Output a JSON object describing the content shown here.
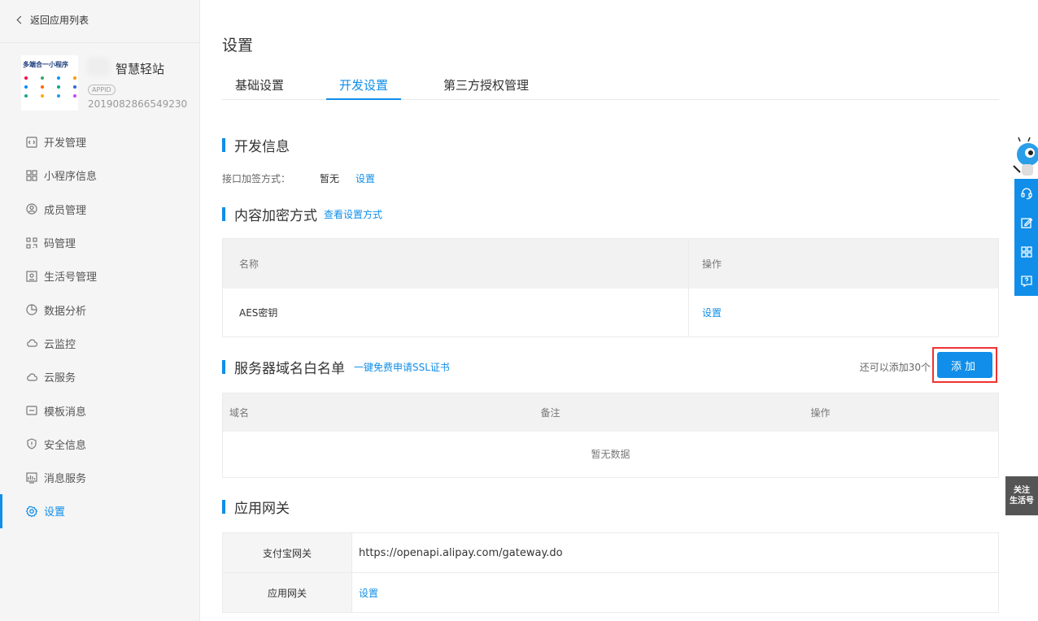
{
  "sidebar": {
    "back_label": "返回应用列表",
    "app": {
      "logo_text": "多端合一小程序",
      "name": "智慧轻站",
      "appid_label": "APPID",
      "appid": "2019082866549230"
    },
    "items": [
      {
        "label": "开发管理",
        "icon": "code-icon"
      },
      {
        "label": "小程序信息",
        "icon": "grid-icon"
      },
      {
        "label": "成员管理",
        "icon": "user-icon"
      },
      {
        "label": "码管理",
        "icon": "qrcode-icon"
      },
      {
        "label": "生活号管理",
        "icon": "life-icon"
      },
      {
        "label": "数据分析",
        "icon": "pie-chart-icon"
      },
      {
        "label": "云监控",
        "icon": "cloud-icon"
      },
      {
        "label": "云服务",
        "icon": "cloud-icon"
      },
      {
        "label": "模板消息",
        "icon": "message-icon"
      },
      {
        "label": "安全信息",
        "icon": "shield-icon"
      },
      {
        "label": "消息服务",
        "icon": "monitor-icon"
      },
      {
        "label": "设置",
        "icon": "gear-icon",
        "active": true
      }
    ]
  },
  "main": {
    "title": "设置",
    "tabs": [
      {
        "label": "基础设置"
      },
      {
        "label": "开发设置",
        "active": true
      },
      {
        "label": "第三方授权管理"
      }
    ],
    "dev_info": {
      "title": "开发信息",
      "sign_label": "接口加签方式：",
      "sign_value": "暂无",
      "sign_action": "设置"
    },
    "encrypt": {
      "title": "内容加密方式",
      "link": "查看设置方式",
      "headers": [
        "名称",
        "操作"
      ],
      "rows": [
        {
          "name": "AES密钥",
          "action": "设置"
        }
      ]
    },
    "whitelist": {
      "title": "服务器域名白名单",
      "link": "一键免费申请SSL证书",
      "remain": "还可以添加30个",
      "add_label": "添加",
      "headers": [
        "域名",
        "备注",
        "操作"
      ],
      "empty": "暂无数据"
    },
    "gateway": {
      "title": "应用网关",
      "rows": [
        {
          "key": "支付宝网关",
          "value": "https://openapi.alipay.com/gateway.do"
        },
        {
          "key": "应用网关",
          "value": "设置"
        }
      ]
    }
  },
  "float": {
    "follow_line1": "关注",
    "follow_line2": "生活号"
  },
  "colors": {
    "accent": "#108ee9",
    "highlight": "#e33333"
  }
}
